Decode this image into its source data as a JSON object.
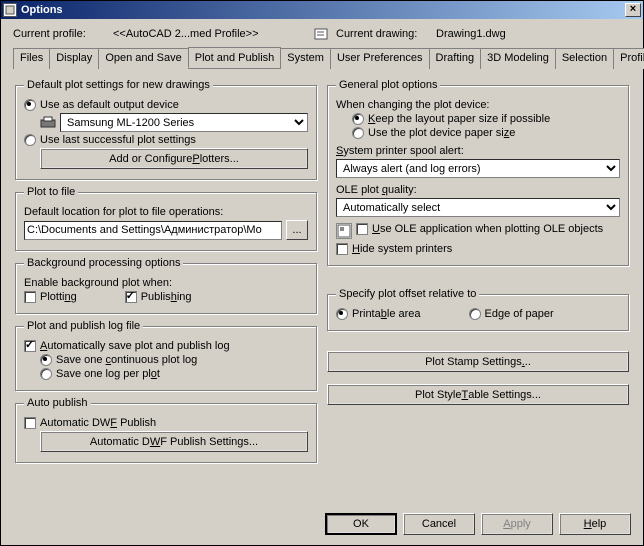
{
  "window": {
    "title": "Options"
  },
  "profile": {
    "label": "Current profile:",
    "value": "<<AutoCAD 2...med Profile>>",
    "drawing_label": "Current drawing:",
    "drawing_value": "Drawing1.dwg"
  },
  "tabs": [
    "Files",
    "Display",
    "Open and Save",
    "Plot and Publish",
    "System",
    "User Preferences",
    "Drafting",
    "3D Modeling",
    "Selection",
    "Profiles"
  ],
  "active_tab": "Plot and Publish",
  "left": {
    "default_plot": {
      "legend": "Default plot settings for new drawings",
      "opt_default": "Use as default output device",
      "default_device": "Samsung ML-1200 Series",
      "opt_last": "Use last successful plot settings",
      "btn_plotters": "Add or Configure Plotters..."
    },
    "plot_file": {
      "legend": "Plot to file",
      "label": "Default location for plot to file operations:",
      "path": "C:\\Documents and Settings\\Администратор\\Мо"
    },
    "bg": {
      "legend": "Background processing options",
      "label": "Enable background plot when:",
      "plotting": "Plotting",
      "publishing": "Publishing"
    },
    "log": {
      "legend": "Plot and publish log file",
      "autosave": "Automatically save plot and publish log",
      "one_continuous": "Save one continuous plot log",
      "one_per": "Save one log per plot"
    },
    "auto": {
      "legend": "Auto publish",
      "auto_dwf": "Automatic DWF Publish",
      "btn_settings": "Automatic DWF Publish Settings..."
    }
  },
  "right": {
    "general": {
      "legend": "General plot options",
      "changing": "When changing the plot device:",
      "keep_layout": "Keep the layout paper size if possible",
      "use_device": "Use the plot device paper size",
      "spool_label": "System printer spool alert:",
      "spool_value": "Always alert (and log errors)",
      "ole_label": "OLE plot quality:",
      "ole_value": "Automatically select",
      "use_ole_app": "Use OLE application when plotting OLE objects",
      "hide_printers": "Hide system printers"
    },
    "offset": {
      "legend": "Specify plot offset relative to",
      "printable": "Printable area",
      "edge": "Edge of paper"
    },
    "btn_stamp": "Plot Stamp Settings...",
    "btn_style": "Plot Style Table Settings..."
  },
  "footer": {
    "ok": "OK",
    "cancel": "Cancel",
    "apply": "Apply",
    "help": "Help"
  }
}
